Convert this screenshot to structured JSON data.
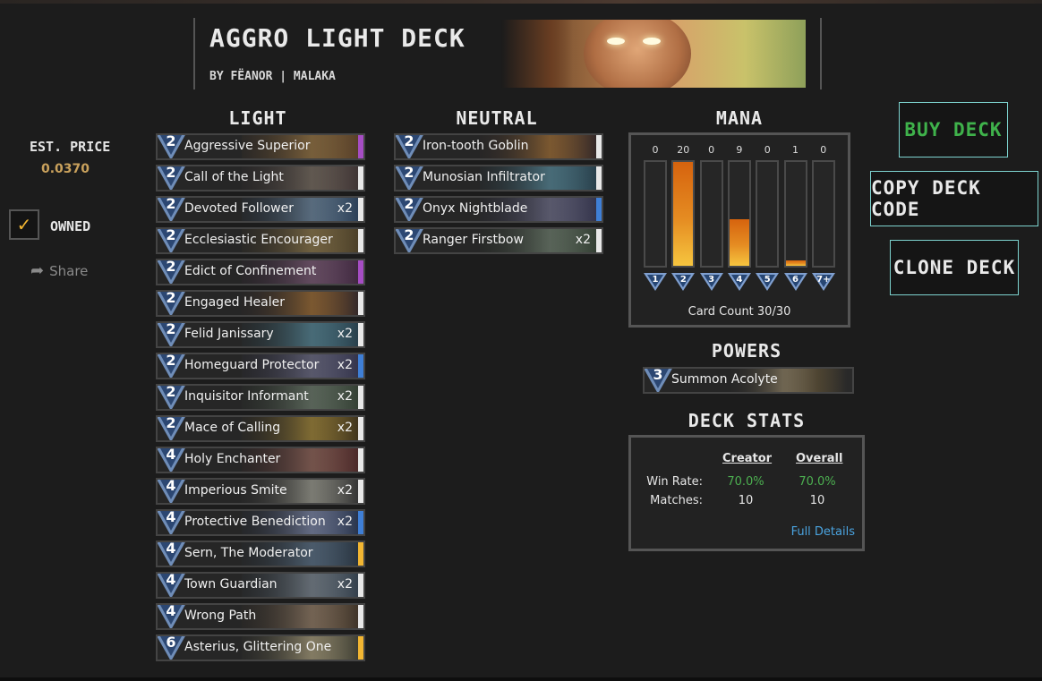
{
  "header": {
    "title": "AGGRO LIGHT DECK",
    "author": "BY FËANOR | MALAKA"
  },
  "pricing": {
    "label": "EST. PRICE",
    "value": "0.0370"
  },
  "owned": {
    "checked": true,
    "check_glyph": "✓",
    "label": "OWNED"
  },
  "share": {
    "icon": "share-icon",
    "label": "Share"
  },
  "columns": {
    "light": "LIGHT",
    "neutral": "NEUTRAL",
    "mana": "MANA",
    "powers": "POWERS",
    "stats": "DECK STATS"
  },
  "light_cards": [
    {
      "cost": "2",
      "name": "Aggressive Superior",
      "count": "",
      "rarity": "#a64dc4"
    },
    {
      "cost": "2",
      "name": "Call of the Light",
      "count": "",
      "rarity": "#e8e8e8"
    },
    {
      "cost": "2",
      "name": "Devoted Follower",
      "count": "x2",
      "rarity": "#e8e8e8"
    },
    {
      "cost": "2",
      "name": "Ecclesiastic Encourager",
      "count": "",
      "rarity": "#e8e8e8"
    },
    {
      "cost": "2",
      "name": "Edict of Confinement",
      "count": "",
      "rarity": "#a64dc4"
    },
    {
      "cost": "2",
      "name": "Engaged Healer",
      "count": "",
      "rarity": "#e8e8e8"
    },
    {
      "cost": "2",
      "name": "Felid Janissary",
      "count": "x2",
      "rarity": "#e8e8e8"
    },
    {
      "cost": "2",
      "name": "Homeguard Protector",
      "count": "x2",
      "rarity": "#3f7fd6"
    },
    {
      "cost": "2",
      "name": "Inquisitor Informant",
      "count": "x2",
      "rarity": "#e8e8e8"
    },
    {
      "cost": "2",
      "name": "Mace of Calling",
      "count": "x2",
      "rarity": "#e8e8e8"
    },
    {
      "cost": "4",
      "name": "Holy Enchanter",
      "count": "",
      "rarity": "#e8e8e8"
    },
    {
      "cost": "4",
      "name": "Imperious Smite",
      "count": "x2",
      "rarity": "#e8e8e8"
    },
    {
      "cost": "4",
      "name": "Protective Benediction",
      "count": "x2",
      "rarity": "#3f7fd6"
    },
    {
      "cost": "4",
      "name": "Sern, The Moderator",
      "count": "",
      "rarity": "#f2b632"
    },
    {
      "cost": "4",
      "name": "Town Guardian",
      "count": "x2",
      "rarity": "#e8e8e8"
    },
    {
      "cost": "4",
      "name": "Wrong Path",
      "count": "",
      "rarity": "#e8e8e8"
    },
    {
      "cost": "6",
      "name": "Asterius, Glittering One",
      "count": "",
      "rarity": "#f2b632"
    }
  ],
  "neutral_cards": [
    {
      "cost": "2",
      "name": "Iron-tooth Goblin",
      "count": "",
      "rarity": "#e8e8e8"
    },
    {
      "cost": "2",
      "name": "Munosian Infiltrator",
      "count": "",
      "rarity": "#e8e8e8"
    },
    {
      "cost": "2",
      "name": "Onyx Nightblade",
      "count": "",
      "rarity": "#3f7fd6"
    },
    {
      "cost": "2",
      "name": "Ranger Firstbow",
      "count": "x2",
      "rarity": "#e8e8e8"
    }
  ],
  "mana_curve": {
    "labels": [
      "1",
      "2",
      "3",
      "4",
      "5",
      "6",
      "7+"
    ],
    "counts": [
      "0",
      "20",
      "0",
      "9",
      "0",
      "1",
      "0"
    ],
    "max": 20,
    "card_count": "Card Count 30/30"
  },
  "powers": [
    {
      "cost": "3",
      "name": "Summon Acolyte"
    }
  ],
  "deck_stats": {
    "col_creator": "Creator",
    "col_overall": "Overall",
    "rows": [
      {
        "label": "Win Rate:",
        "creator": "70.0%",
        "overall": "70.0%",
        "color": "#4caf50"
      },
      {
        "label": "Matches:",
        "creator": "10",
        "overall": "10",
        "color": "#e6e6e6"
      }
    ],
    "link": "Full Details"
  },
  "buttons": {
    "buy": "BUY DECK",
    "copy": "COPY DECK CODE",
    "clone": "CLONE DECK"
  },
  "colors": {
    "accent_gold": "#c9a15c",
    "button_border": "#7dd3cf",
    "buy_green": "#3fb24b",
    "link_blue": "#4aa3df",
    "mana_orange": "#e58c22"
  }
}
